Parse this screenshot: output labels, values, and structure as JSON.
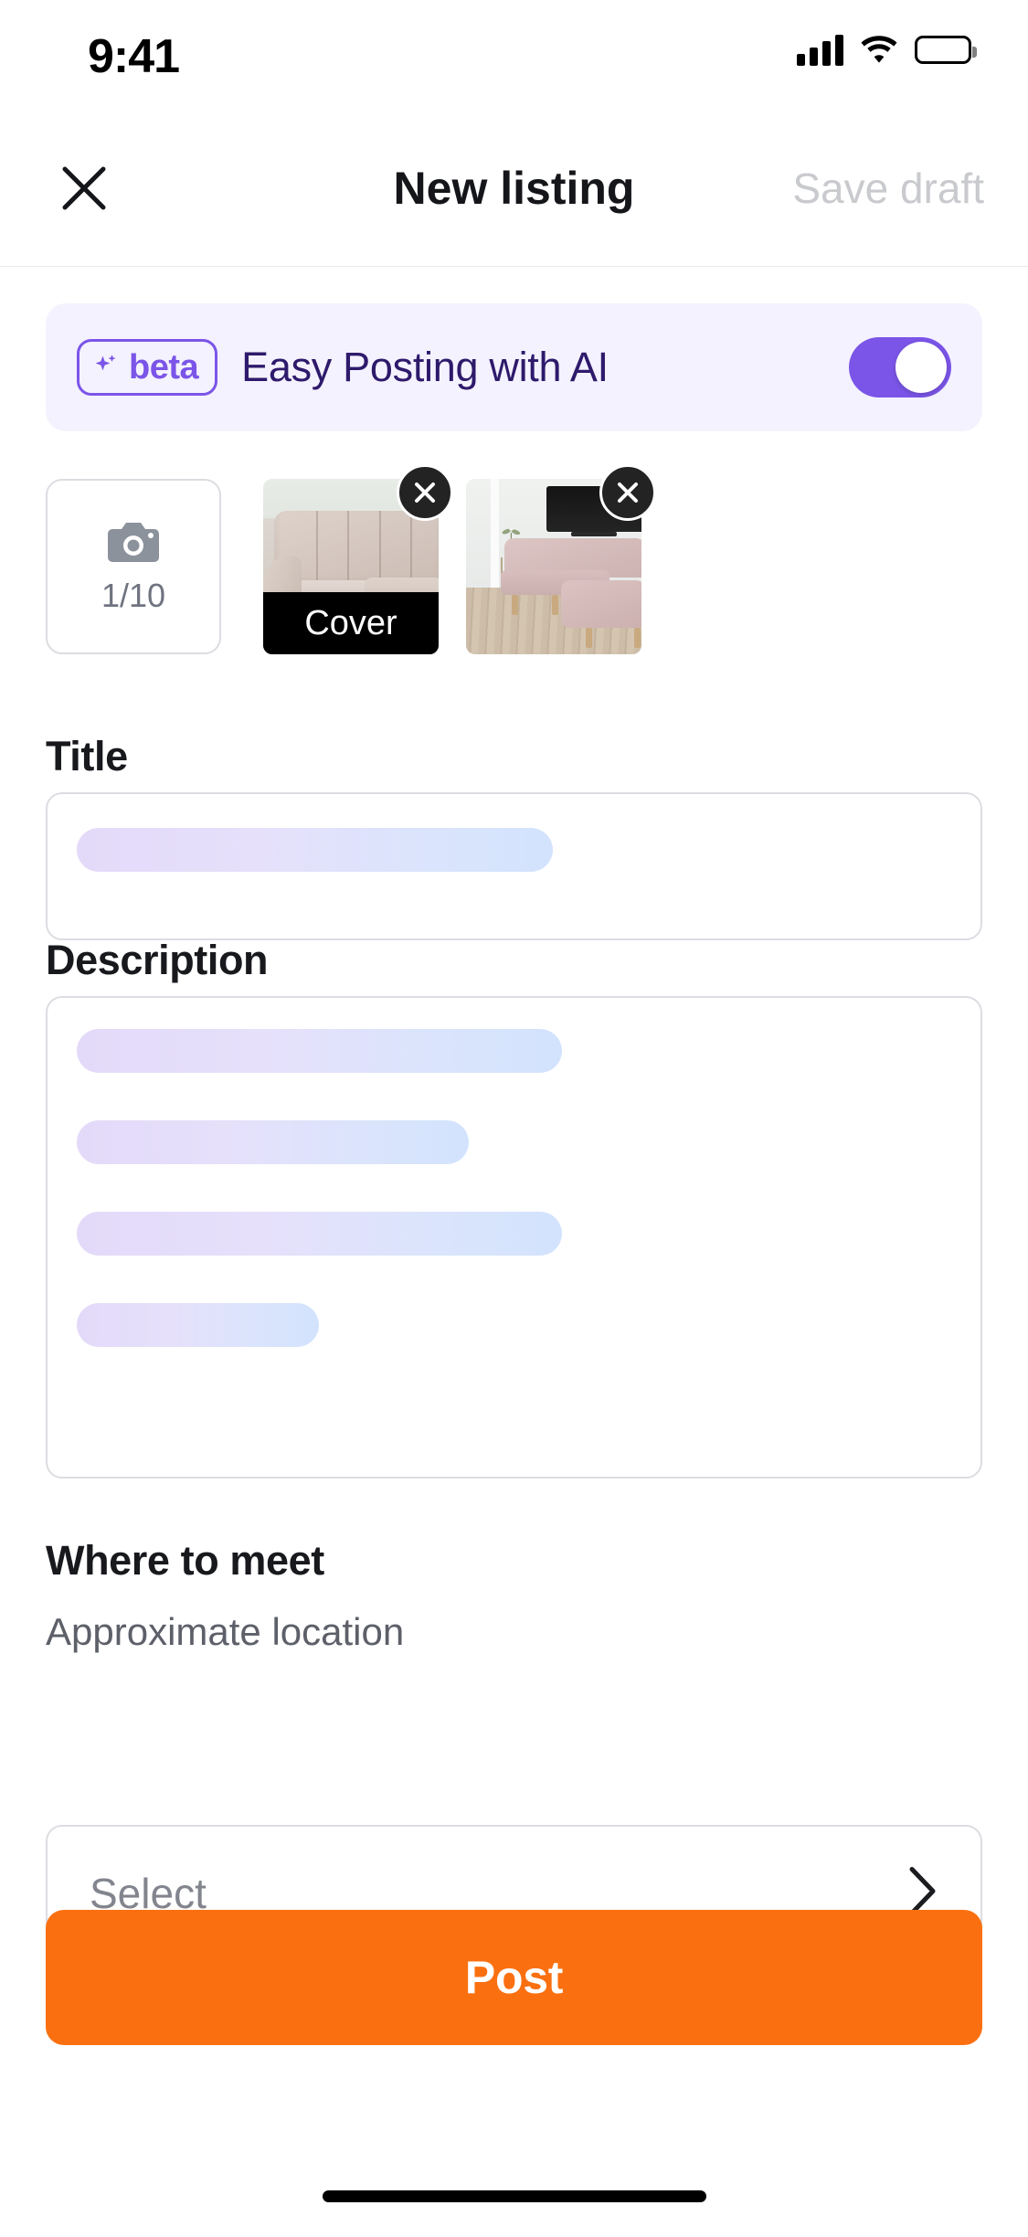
{
  "status_bar": {
    "time": "9:41",
    "signal_icon": "cellular-signal-icon",
    "wifi_icon": "wifi-icon",
    "battery_icon": "battery-full-icon"
  },
  "header": {
    "close_icon": "close-icon",
    "title": "New listing",
    "save_draft_label": "Save draft"
  },
  "ai_banner": {
    "badge_label": "beta",
    "badge_icon": "sparkle-icon",
    "text": "Easy Posting with AI",
    "toggle_state": "on",
    "accent_color": "#7b55e8",
    "background_color": "#f4f2fe",
    "text_color": "#2e1a6b"
  },
  "photos": {
    "add_label": "1/10",
    "add_icon": "camera-icon",
    "items": [
      {
        "alt": "Beige tufted sofa",
        "badge": "Cover",
        "remove_icon": "close-circle-icon"
      },
      {
        "alt": "Pink sectional sofa in living room with wall TV",
        "badge": "",
        "remove_icon": "close-circle-icon"
      }
    ]
  },
  "title_section": {
    "label": "Title",
    "value": "",
    "placeholder": "",
    "skeleton_widths": [
      "51%"
    ]
  },
  "description_section": {
    "label": "Description",
    "value": "",
    "placeholder": "",
    "skeleton_widths": [
      "52%",
      "41%",
      "52%",
      "26%"
    ]
  },
  "location_section": {
    "label": "Where to meet",
    "sublabel": "Approximate location",
    "select_value": "",
    "select_placeholder": "Select",
    "chevron_icon": "chevron-right-icon"
  },
  "footer": {
    "post_label": "Post",
    "post_color": "#fa7011"
  }
}
